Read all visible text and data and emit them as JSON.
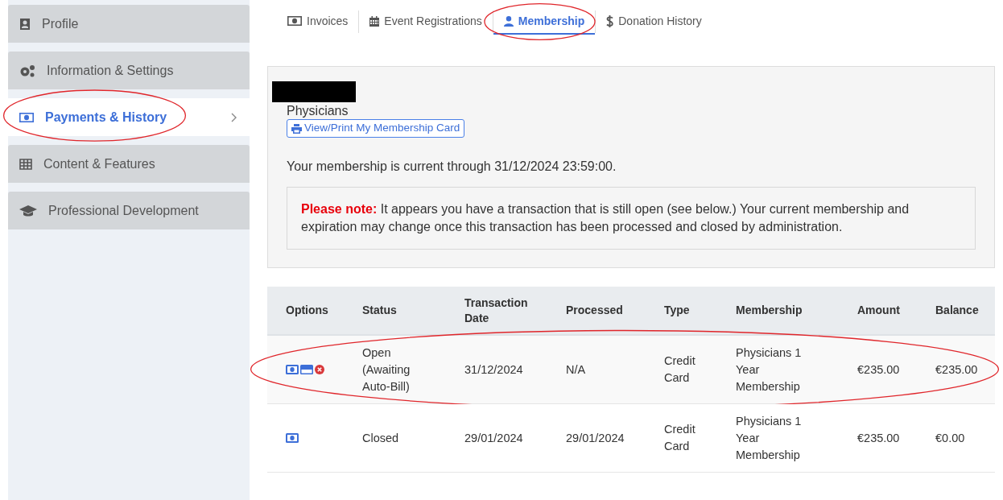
{
  "sidebar": {
    "items": [
      {
        "label": "Profile",
        "selected": false,
        "highlighted": false
      },
      {
        "label": "Information & Settings",
        "selected": false,
        "highlighted": false
      },
      {
        "label": "Payments & History",
        "selected": true,
        "highlighted": true
      },
      {
        "label": "Content & Features",
        "selected": false,
        "highlighted": false
      },
      {
        "label": "Professional Development",
        "selected": false,
        "highlighted": false
      }
    ]
  },
  "tabs": [
    {
      "label": "Invoices",
      "selected": false,
      "highlighted": false
    },
    {
      "label": "Event Registrations",
      "selected": false,
      "highlighted": false
    },
    {
      "label": "Membership",
      "selected": true,
      "highlighted": true
    },
    {
      "label": "Donation History",
      "selected": false,
      "highlighted": false
    }
  ],
  "membership": {
    "name_redacted": true,
    "category": "Physicians",
    "card_button": "View/Print My Membership Card",
    "current_text": "Your membership is current through 31/12/2024 23:59:00.",
    "notice": "**Please note:** It appears you have a transaction that is still open (see below.) Your current membership and expiration may change once this transaction has been processed and closed by administration."
  },
  "table": {
    "columns": [
      "Options",
      "Status",
      "Transaction Date",
      "Processed",
      "Type",
      "Membership",
      "Amount",
      "Balance"
    ],
    "rows": [
      {
        "cells": [
          {
            "options": [
              {
                "kind": "cash"
              },
              {
                "kind": "card"
              },
              {
                "kind": "cancel"
              }
            ]
          },
          "Open (Awaiting Auto-Bill)",
          "31/12/2024",
          "N/A",
          "Credit Card",
          "Physicians 1 Year Membership",
          "€235.00",
          "€235.00"
        ],
        "highlighted": true
      },
      {
        "cells": [
          {
            "options": [
              {
                "kind": "cash"
              }
            ]
          },
          "Closed",
          "29/01/2024",
          "29/01/2024",
          "Credit Card",
          "Physicians 1 Year Membership",
          "€235.00",
          "€0.00"
        ],
        "highlighted": false
      }
    ]
  }
}
